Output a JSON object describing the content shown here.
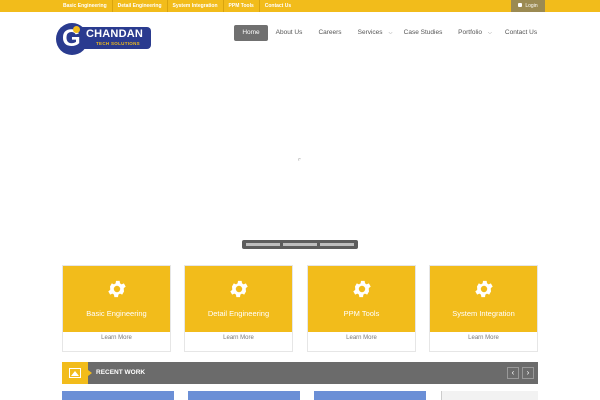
{
  "top_bar": {
    "links": [
      "Basic Engineering",
      "Detail Engineering",
      "System Integration",
      "PPM Tools",
      "Contact Us"
    ],
    "login_label": "Login"
  },
  "logo": {
    "name": "CHANDAN",
    "subtitle": "TECH SOLUTIONS"
  },
  "nav": {
    "items": [
      {
        "label": "Home",
        "active": true,
        "has_dropdown": false
      },
      {
        "label": "About Us",
        "active": false,
        "has_dropdown": false
      },
      {
        "label": "Careers",
        "active": false,
        "has_dropdown": false
      },
      {
        "label": "Services",
        "active": false,
        "has_dropdown": true
      },
      {
        "label": "Case Studies",
        "active": false,
        "has_dropdown": false
      },
      {
        "label": "Portfolio",
        "active": false,
        "has_dropdown": true
      },
      {
        "label": "Contact Us",
        "active": false,
        "has_dropdown": false
      }
    ]
  },
  "services": [
    {
      "title": "Basic Engineering",
      "link": "Learn More",
      "icon": "gear-icon"
    },
    {
      "title": "Detail Engineering",
      "link": "Learn More",
      "icon": "gear-icon"
    },
    {
      "title": "PPM Tools",
      "link": "Learn More",
      "icon": "gear-icon"
    },
    {
      "title": "System Integration",
      "link": "Learn More",
      "icon": "gear-icon"
    }
  ],
  "recent_work": {
    "label": "RECENT WORK",
    "prev_icon": "chevron-left-icon",
    "next_icon": "chevron-right-icon"
  },
  "colors": {
    "accent": "#f2bc1b",
    "brand_blue": "#2a3b8f",
    "dark_bar": "#6b6b6b",
    "nav_active": "#707070"
  }
}
